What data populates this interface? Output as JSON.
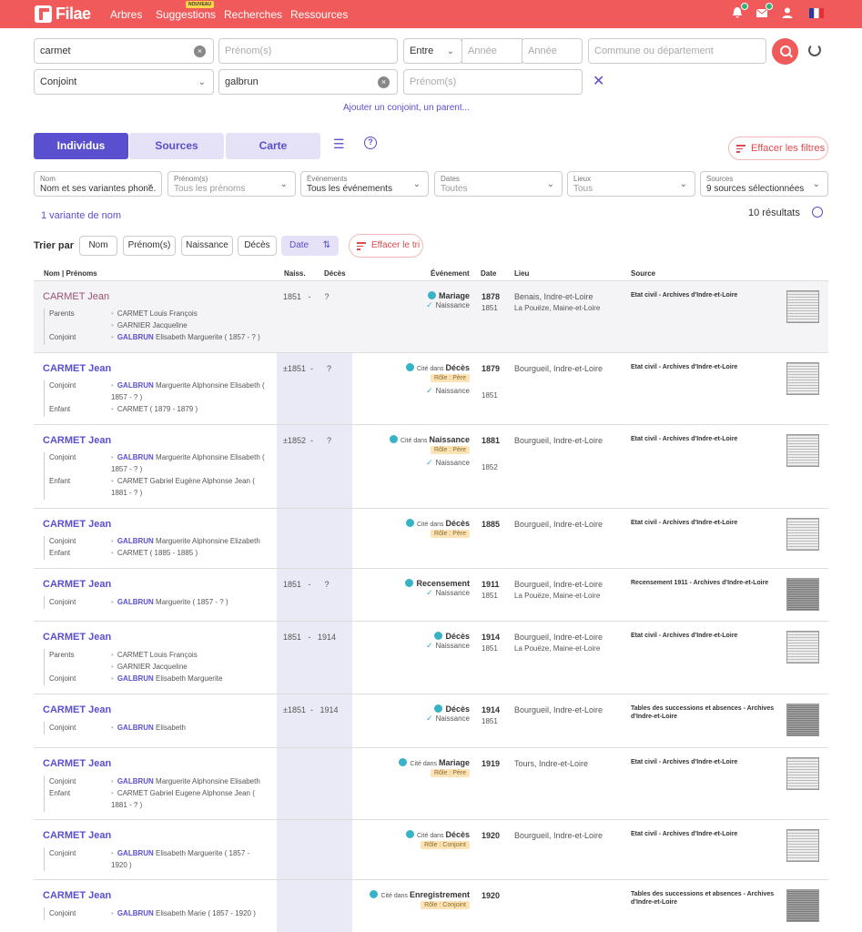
{
  "nav": {
    "logo": "Filae",
    "items": [
      "Arbres",
      "Suggestions",
      "Recherches",
      "Ressources"
    ],
    "new_badge": "NOUVEAU"
  },
  "search": {
    "name_value": "carmet",
    "firstname_placeholder": "Prénom(s)",
    "between_label": "Entre",
    "year_from_placeholder": "Année",
    "year_to_placeholder": "Année",
    "place_placeholder": "Commune ou département",
    "relation_select": "Conjoint",
    "relation_name_value": "galbrun",
    "relation_firstname_placeholder": "Prénom(s)",
    "add_relation_link": "Ajouter un conjoint, un parent..."
  },
  "tabs": [
    "Individus",
    "Sources",
    "Carte"
  ],
  "clear_filters": "Effacer les filtres",
  "filters": [
    {
      "label": "Nom",
      "value": "Nom et ses variantes phoné..."
    },
    {
      "label": "Prénom(s)",
      "value": "Tous les prénoms"
    },
    {
      "label": "Événements",
      "value": "Tous les événements"
    },
    {
      "label": "Dates",
      "value": "Toutes"
    },
    {
      "label": "Lieux",
      "value": "Tous"
    },
    {
      "label": "Sources",
      "value": "9 sources sélectionnées"
    }
  ],
  "variant_link": "1 variante de nom",
  "results_count": "10 résultats",
  "sort": {
    "label": "Trier par",
    "buttons": [
      "Nom",
      "Prénom(s)",
      "Naissance",
      "Décès",
      "Date"
    ],
    "clear": "Effacer le tri"
  },
  "table_headers": {
    "name": "Nom | Prénoms",
    "birth": "Naiss.",
    "death": "Décès",
    "event": "Événement",
    "date": "Date",
    "place": "Lieu",
    "source": "Source"
  },
  "rows": [
    {
      "name": "CARMET Jean"
    },
    {
      "name": "CARMET Jean"
    },
    {
      "name": "CARMET Jean"
    },
    {
      "name": "CARMET Jean"
    },
    {
      "name": "CARMET Jean"
    },
    {
      "name": "CARMET Jean"
    },
    {
      "name": "CARMET Jean"
    },
    {
      "name": "CARMET Jean"
    },
    {
      "name": "CARMET Jean"
    },
    {
      "name": "CARMET Jean"
    }
  ]
}
